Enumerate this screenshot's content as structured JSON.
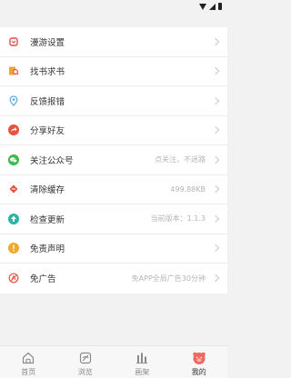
{
  "menu": {
    "items": [
      {
        "label": "漫游设置",
        "value": "",
        "icon": "roaming-settings-icon",
        "color": "#e54a4a"
      },
      {
        "label": "找书求书",
        "value": "",
        "icon": "book-search-icon",
        "color": "#f2a23b"
      },
      {
        "label": "反馈报错",
        "value": "",
        "icon": "feedback-icon",
        "color": "#5aa9e6"
      },
      {
        "label": "分享好友",
        "value": "",
        "icon": "share-icon",
        "color": "#e8533f"
      },
      {
        "label": "关注公众号",
        "value": "点关注，不迷路",
        "icon": "wechat-icon",
        "color": "#3cb94a"
      },
      {
        "label": "清除缓存",
        "value": "499.88KB",
        "icon": "clear-cache-icon",
        "color": "#e8533f"
      },
      {
        "label": "检查更新",
        "value": "当前版本：1.1.3",
        "icon": "update-icon",
        "color": "#2bb3a3"
      },
      {
        "label": "免责声明",
        "value": "",
        "icon": "disclaimer-icon",
        "color": "#f0a928"
      },
      {
        "label": "免广告",
        "value": "免APP全局广告30分钟",
        "icon": "no-ads-icon",
        "color": "#e8533f"
      }
    ]
  },
  "tabbar": {
    "items": [
      {
        "label": "首页",
        "icon": "home-icon",
        "active": false
      },
      {
        "label": "浏览",
        "icon": "browse-icon",
        "active": false
      },
      {
        "label": "画架",
        "icon": "shelf-icon",
        "active": false
      },
      {
        "label": "我的",
        "icon": "profile-icon",
        "active": true
      }
    ],
    "accent": "#ee6a5e"
  }
}
